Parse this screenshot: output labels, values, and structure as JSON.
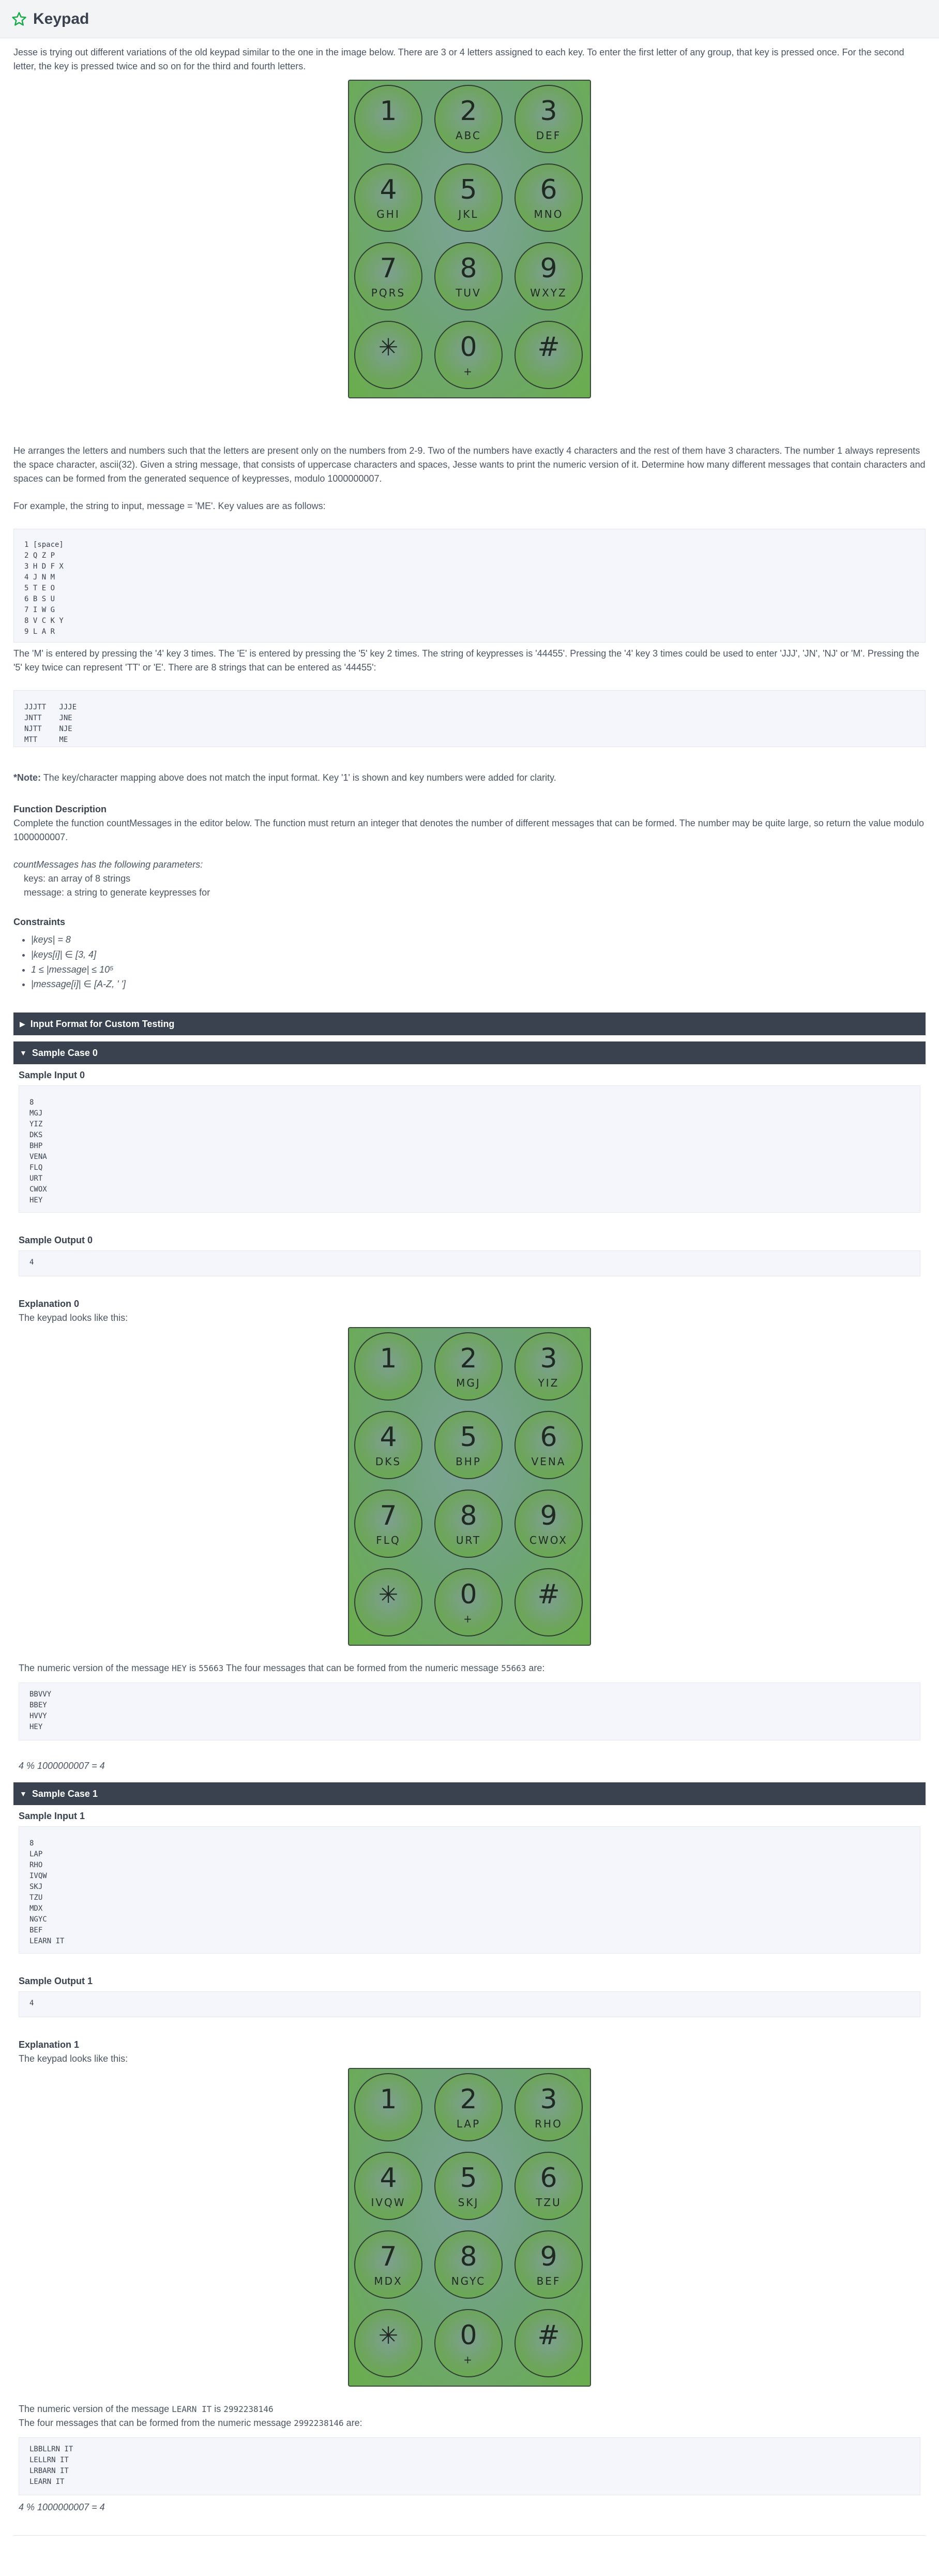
{
  "header": {
    "title": "Keypad",
    "icon": "star-icon"
  },
  "intro": "Jesse is trying out different variations of the old keypad similar to the one in the image below. There are 3 or 4 letters assigned to each key. To enter the first letter of any group, that key is pressed once. For the second letter, the key is pressed twice and so on for the third and fourth letters.",
  "keypad_main": [
    {
      "n": "1",
      "l": ""
    },
    {
      "n": "2",
      "l": "ABC"
    },
    {
      "n": "3",
      "l": "DEF"
    },
    {
      "n": "4",
      "l": "GHI"
    },
    {
      "n": "5",
      "l": "JKL"
    },
    {
      "n": "6",
      "l": "MNO"
    },
    {
      "n": "7",
      "l": "PQRS"
    },
    {
      "n": "8",
      "l": "TUV"
    },
    {
      "n": "9",
      "l": "WXYZ"
    },
    {
      "n": "*",
      "l": ""
    },
    {
      "n": "0",
      "l": "+"
    },
    {
      "n": "#",
      "l": ""
    }
  ],
  "para2": "He arranges the letters and numbers such that the letters are present only on the numbers from 2-9. Two of the numbers have exactly 4 characters and the rest of them have 3 characters. The number 1 always represents the space character, ascii(32). Given a string message, that consists of uppercase characters and spaces, Jesse wants to print the numeric version of it. Determine how many different messages that contain characters and spaces can be formed from the generated sequence of keypresses, modulo 1000000007.",
  "para3": "For example, the string to input, message = 'ME'. Key values are as follows:",
  "code_keys": "1 [space]\n2 Q Z P\n3 H D F X\n4 J N M\n5 T E O\n6 B S U\n7 I W G\n8 V C K Y\n9 L A R",
  "para4": "The 'M' is entered by pressing the '4' key 3 times. The 'E' is entered by pressing the '5' key 2 times. The string of keypresses is '44455'. Pressing the '4' key 3 times could be used to enter 'JJJ', 'JN', 'NJ' or 'M'. Pressing the '5' key twice can represent 'TT' or 'E'. There are 8 strings that can be entered as '44455':",
  "code_strings": "JJJTT   JJJE\nJNTT    JNE\nNJTT    NJE\nMTT     ME",
  "note_label": "*Note:",
  "note_text": "The key/character mapping above does not match the input format. Key '1' is shown and key numbers were added for clarity.",
  "fd_title": "Function Description",
  "fd_text": "Complete the function countMessages in the editor below. The function must return an integer that denotes the number of different messages that can be formed. The number may be quite large, so return the value modulo 1000000007.",
  "params_intro": "countMessages has the following parameters:",
  "param1": "keys: an array of 8 strings",
  "param2": "message: a string to generate keypresses for",
  "constraints_title": "Constraints",
  "constraints": [
    "|keys| = 8",
    "|keys[i]| ∈ [3, 4]",
    "1 ≤ |message| ≤ 10⁵",
    "|message[i]| ∈ [A-Z, ' ']"
  ],
  "acc_custom": "Input Format for Custom Testing",
  "sample0": {
    "header": "Sample Case 0",
    "input_title": "Sample Input 0",
    "input": "8\nMGJ\nYIZ\nDKS\nBHP\nVENA\nFLQ\nURT\nCWOX\nHEY",
    "output_title": "Sample Output 0",
    "output": "4",
    "expl_title": "Explanation 0",
    "expl_text": "The keypad looks like this:",
    "keypad": [
      {
        "n": "1",
        "l": ""
      },
      {
        "n": "2",
        "l": "MGJ"
      },
      {
        "n": "3",
        "l": "YIZ"
      },
      {
        "n": "4",
        "l": "DKS"
      },
      {
        "n": "5",
        "l": "BHP"
      },
      {
        "n": "6",
        "l": "VENA"
      },
      {
        "n": "7",
        "l": "FLQ"
      },
      {
        "n": "8",
        "l": "URT"
      },
      {
        "n": "9",
        "l": "CWOX"
      },
      {
        "n": "*",
        "l": ""
      },
      {
        "n": "0",
        "l": "+"
      },
      {
        "n": "#",
        "l": ""
      }
    ],
    "numeric_a": "The numeric version of the message",
    "numeric_msg": "HEY",
    "numeric_b": "is",
    "numeric_val": "55663",
    "numeric_c": "The four messages that can be formed from the numeric message",
    "numeric_val2": "55663",
    "numeric_d": "are:",
    "messages": "BBVVY\nBBEY\nHVVY\nHEY",
    "result": "4 % 1000000007 = 4"
  },
  "sample1": {
    "header": "Sample Case 1",
    "input_title": "Sample Input 1",
    "input": "8\nLAP\nRHO\nIVQW\nSKJ\nTZU\nMDX\nNGYC\nBEF\nLEARN IT",
    "output_title": "Sample Output 1",
    "output": "4",
    "expl_title": "Explanation 1",
    "expl_text": "The keypad looks like this:",
    "keypad": [
      {
        "n": "1",
        "l": ""
      },
      {
        "n": "2",
        "l": "LAP"
      },
      {
        "n": "3",
        "l": "RHO"
      },
      {
        "n": "4",
        "l": "IVQW"
      },
      {
        "n": "5",
        "l": "SKJ"
      },
      {
        "n": "6",
        "l": "TZU"
      },
      {
        "n": "7",
        "l": "MDX"
      },
      {
        "n": "8",
        "l": "NGYC"
      },
      {
        "n": "9",
        "l": "BEF"
      },
      {
        "n": "*",
        "l": ""
      },
      {
        "n": "0",
        "l": "+"
      },
      {
        "n": "#",
        "l": ""
      }
    ],
    "numeric_a": "The numeric version of the message",
    "numeric_msg": "LEARN IT",
    "numeric_b": "is",
    "numeric_val": "2992238146",
    "numeric_c": "The four messages that can be formed from the numeric message",
    "numeric_val2": "2992238146",
    "numeric_d": "are:",
    "messages": "LBBLLRN IT\nLELLRN IT\nLRBARN IT\nLEARN IT",
    "result": "4 % 1000000007 = 4"
  }
}
